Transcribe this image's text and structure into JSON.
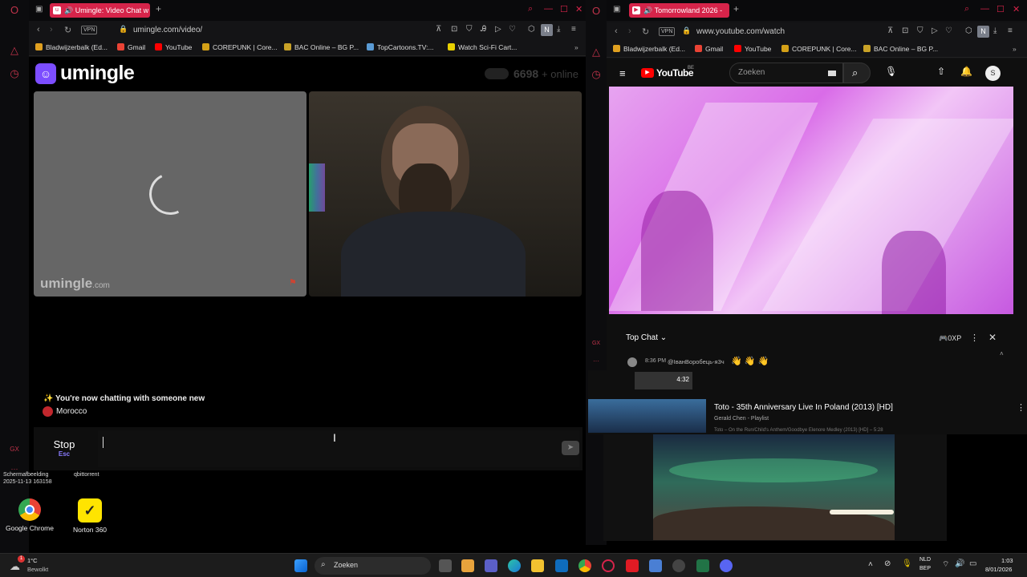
{
  "left_browser": {
    "tab_title": "Umingle: Video Chat w",
    "url": "umingle.com/video/",
    "vpn": "VPN",
    "bookmarks": [
      {
        "label": "Bladwijzerbalk (Ed...",
        "color": "#e0a020"
      },
      {
        "label": "Gmail",
        "color": "#ea4335"
      },
      {
        "label": "YouTube",
        "color": "#ff0000"
      },
      {
        "label": "COREPUNK | Core...",
        "color": "#d4a017"
      },
      {
        "label": "BAC Online – BG P...",
        "color": "#c9a227"
      },
      {
        "label": "TopCartoons.TV:...",
        "color": "#5a9bd5"
      },
      {
        "label": "Watch Sci-Fi Cart...",
        "color": "#e8d000"
      }
    ],
    "profile_letter": "N"
  },
  "umingle": {
    "logo": "umingle",
    "online_count": "6698",
    "online_label": "+ online",
    "watermark": "umingle",
    "watermark_suffix": ".com",
    "new_chat_msg": "✨ You're now chatting with someone new",
    "country": "Morocco",
    "stop_label": "Stop",
    "stop_key": "Esc"
  },
  "right_browser": {
    "tab_title": "Tomorrowland 2026 -",
    "url": "www.youtube.com/watch",
    "vpn": "VPN",
    "bookmarks": [
      {
        "label": "Bladwijzerbalk (Ed...",
        "color": "#e0a020"
      },
      {
        "label": "Gmail",
        "color": "#ea4335"
      },
      {
        "label": "YouTube",
        "color": "#ff0000"
      },
      {
        "label": "COREPUNK | Core...",
        "color": "#d4a017"
      },
      {
        "label": "BAC Online – BG P...",
        "color": "#c9a227"
      }
    ],
    "profile_letter": "N"
  },
  "youtube": {
    "logo": "YouTube",
    "region": "BE",
    "search_placeholder": "Zoeken",
    "avatar_letter": "S",
    "chat_mode": "Top Chat",
    "xp": "0XP",
    "chat_time": "8:36 PM",
    "chat_user": "@ІванВоробець-я3ч",
    "chat_text": "👋 👋 👋",
    "short_duration": "4:32",
    "rec_title": "Toto - 35th Anniversary Live In Poland (2013) [HD]",
    "rec_channel": "Gerald Chen - Playlist",
    "rec_desc": "Toto – On the Run/Child's Anthem/Goodbye Elenore Medley (2013) [HD] – 5:28"
  },
  "desktop": {
    "partial_file1": "Schermafbeelding",
    "partial_file1_date": "2025-11-13 163158",
    "partial_file2": "qbittorrent",
    "icons": [
      {
        "label": "Google Chrome"
      },
      {
        "label": "Norton 360"
      }
    ]
  },
  "taskbar": {
    "weather_temp": "1°C",
    "weather_desc": "Bewolkt",
    "search": "Zoeken",
    "lang1": "NLD",
    "lang2": "BEP",
    "time": "1:03",
    "date": "8/01/2026"
  }
}
